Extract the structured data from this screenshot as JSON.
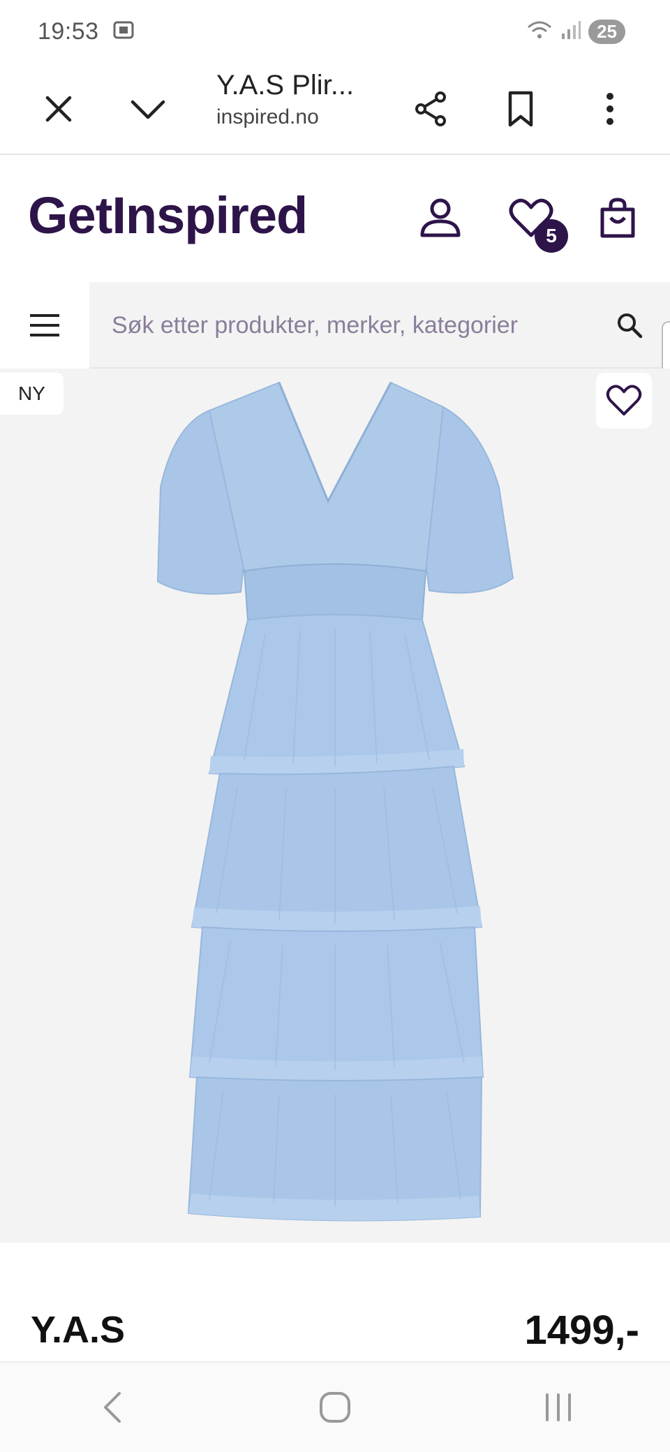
{
  "status_bar": {
    "time": "19:53",
    "battery": "25",
    "icons": [
      "screen-record-icon",
      "wifi-icon",
      "signal-icon"
    ]
  },
  "browser": {
    "title": "Y.A.S Plir...",
    "url": "inspired.no",
    "icons": [
      "close-icon",
      "chevron-down-icon",
      "share-icon",
      "bookmark-icon",
      "more-vert-icon"
    ]
  },
  "header": {
    "logo": "GetInspired",
    "wishlist_count": "5",
    "icons": [
      "account-icon",
      "heart-icon",
      "shopping-bag-icon"
    ],
    "brand_color": "#2d1449"
  },
  "search": {
    "placeholder": "Søk etter produkter, merker, kategorier",
    "icons": [
      "menu-icon",
      "search-icon"
    ]
  },
  "product": {
    "badge": "NY",
    "brand": "Y.A.S",
    "price": "1499,-",
    "dress_color": "#a9c6e8",
    "image_background": "#f3f3f3"
  },
  "navigation": {
    "icons": [
      "back-icon",
      "home-icon",
      "recents-icon"
    ]
  }
}
